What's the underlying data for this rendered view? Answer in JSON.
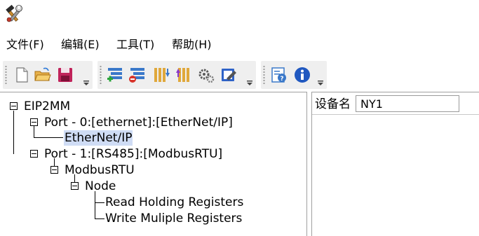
{
  "menu": [
    {
      "label": "文件(F)"
    },
    {
      "label": "编辑(E)"
    },
    {
      "label": "工具(T)"
    },
    {
      "label": "帮助(H)"
    }
  ],
  "toolbar_icons": [
    "new-file-icon",
    "open-folder-icon",
    "save-icon",
    "add-row-icon",
    "remove-row-icon",
    "move-down-icon",
    "move-up-icon",
    "settings-gears-icon",
    "edit-icon",
    "help-doc-icon",
    "info-icon"
  ],
  "tree": {
    "root": "EIP2MM",
    "port0": "Port - 0:[ethernet]:[EtherNet/IP]",
    "ethernetip": "EtherNet/IP",
    "port1": "Port - 1:[RS485]:[ModbusRTU]",
    "modbusrtu": "ModbusRTU",
    "node": "Node",
    "read_holding": "Read Holding Registers",
    "write_multiple": "Write Muliple Registers"
  },
  "properties": {
    "device_name_label": "设备名",
    "device_name_value": "NY1"
  }
}
